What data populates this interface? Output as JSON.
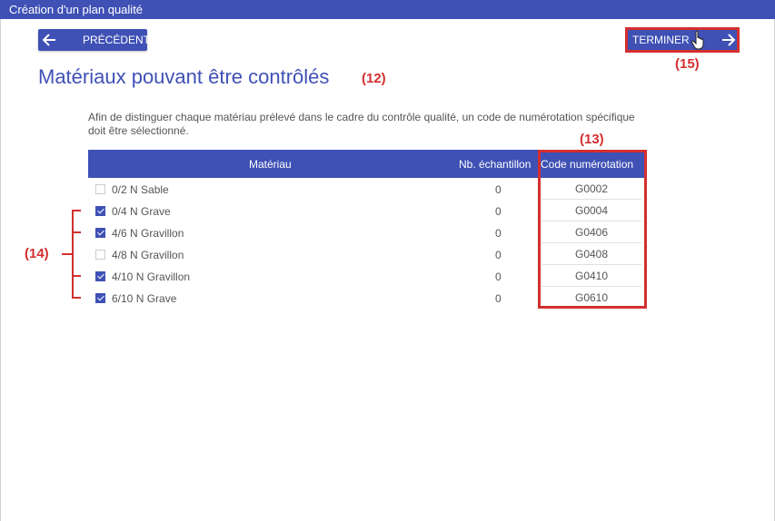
{
  "window": {
    "title": "Création d'un plan qualité"
  },
  "nav": {
    "prev_label": "PRÉCÉDENT",
    "next_label": "TERMINER"
  },
  "page": {
    "title": "Matériaux pouvant être contrôlés",
    "description": "Afin de distinguer chaque matériau prélevé dans le cadre du contrôle qualité, un code de numérotation spécifique doit être sélectionné."
  },
  "table": {
    "headers": [
      "Matériau",
      "Nb. échantillon",
      "Code numérotation"
    ],
    "rows": [
      {
        "checked": false,
        "material": "0/2 N Sable",
        "samples": "0",
        "code": "G0002"
      },
      {
        "checked": true,
        "material": "0/4 N Grave",
        "samples": "0",
        "code": "G0004"
      },
      {
        "checked": true,
        "material": "4/6 N Gravillon",
        "samples": "0",
        "code": "G0406"
      },
      {
        "checked": false,
        "material": "4/8 N Gravillon",
        "samples": "0",
        "code": "G0408"
      },
      {
        "checked": true,
        "material": "4/10 N Gravillon",
        "samples": "0",
        "code": "G0410"
      },
      {
        "checked": true,
        "material": "6/10 N Grave",
        "samples": "0",
        "code": "G0610"
      }
    ]
  },
  "annotations": {
    "a12": "(12)",
    "a13": "(13)",
    "a14": "(14)",
    "a15": "(15)"
  },
  "colors": {
    "primary": "#3f51b5",
    "annotation": "#d32f2f"
  }
}
